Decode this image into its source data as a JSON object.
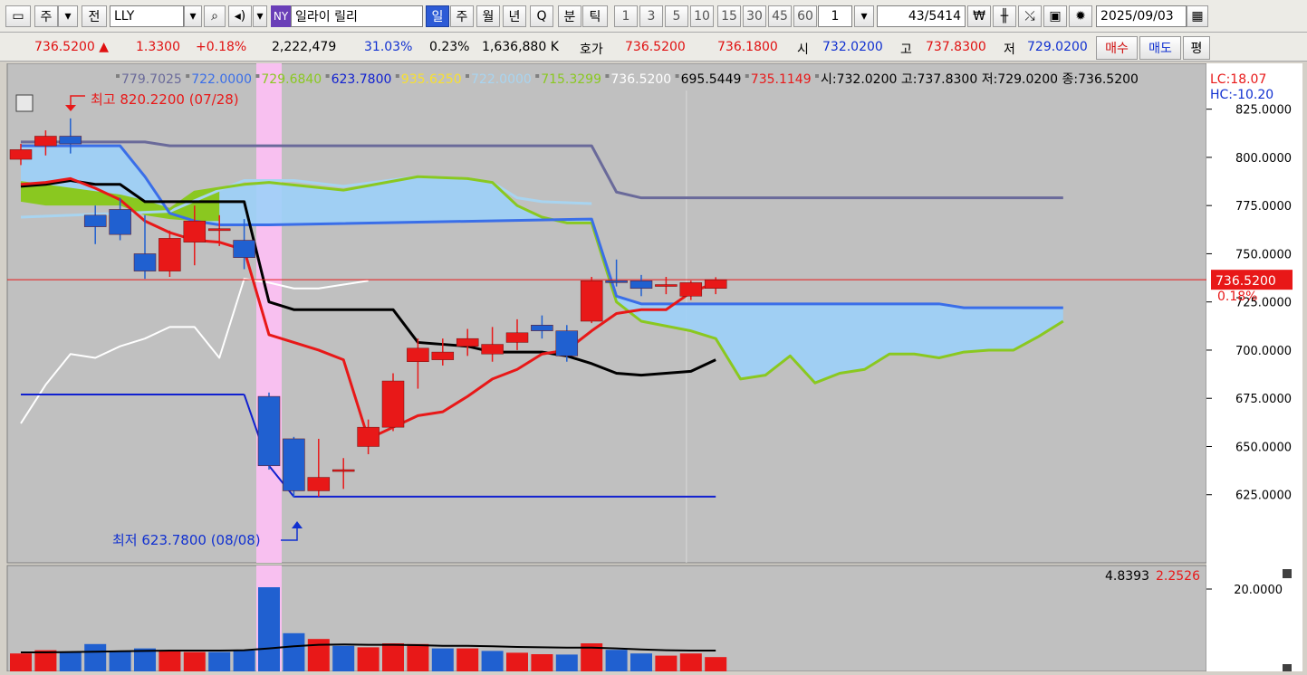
{
  "toolbar": {
    "period_label": "주",
    "prev_label": "전",
    "symbol_code": "LLY",
    "exchange_badge": "NY",
    "symbol_name": "일라이 릴리",
    "period_tabs": [
      "일",
      "주",
      "월",
      "년",
      "Q",
      "분",
      "틱"
    ],
    "minute_tabs": [
      "1",
      "3",
      "5",
      "10",
      "15",
      "30",
      "45",
      "60"
    ],
    "tick_value": "1",
    "counter": "43",
    "counter_total": "/5414",
    "date": "2025/09/03"
  },
  "quote": {
    "price": "736.5200",
    "change_arrow": "▲",
    "change": "1.3300",
    "change_pct": "+0.18%",
    "volume": "2,222,479",
    "vol_ratio": "31.03%",
    "turnover_pct": "0.23%",
    "amount": "1,636,880",
    "amount_unit": "K",
    "hoga_label": "호가",
    "ask": "736.5200",
    "bid": "736.1800",
    "open_label": "시",
    "open": "732.0200",
    "high_label": "고",
    "high": "737.8300",
    "low_label": "저",
    "low": "729.0200",
    "buy_label": "매수",
    "sell_label": "매도",
    "eval_label": "평"
  },
  "colors": {
    "up": "#e81818",
    "down": "#2060d0",
    "ma_black": "#000000",
    "ma_red": "#e81818",
    "ma_white": "#ffffff",
    "ichimoku_blue": "#3a6ee8",
    "ichimoku_navy": "#6a6a9a",
    "cloud_green": "#8ac820",
    "cloud_blue": "#9cd0f8",
    "chikou_lightblue": "#a8d4f0",
    "channel_blue": "#1020d0",
    "highlight": "#f8c0f0",
    "bg": "#c0c0c0"
  },
  "chart_data": [
    {
      "type": "candlestick",
      "legend": [
        {
          "text": "779.7025",
          "color": "#6a6a9a"
        },
        {
          "text": "722.0000",
          "color": "#3a6ee8"
        },
        {
          "text": "729.6840",
          "color": "#8ac820"
        },
        {
          "text": "623.7800",
          "color": "#1020d0"
        },
        {
          "text": "935.6250",
          "color": "#f8e030"
        },
        {
          "text": "722.0000",
          "color": "#a8d4f0"
        },
        {
          "text": "715.3299",
          "color": "#8ac820"
        },
        {
          "text": "736.5200",
          "color": "#ffffff"
        },
        {
          "text": "695.5449",
          "color": "#000000"
        },
        {
          "text": "735.1149",
          "color": "#e81818"
        },
        {
          "text": "시:732.0200 고:737.8300 저:729.0200 종:736.5200",
          "color": "#000000"
        }
      ],
      "lc_label": "LC:18.07",
      "hc_label": "HC:-10.20",
      "high_annotation": "최고 820.2200 (07/28)",
      "low_annotation": "최저 623.7800 (08/08)",
      "current_price_tag": "736.5200",
      "current_change_tag": "0.18%",
      "ylim": [
        600,
        830
      ],
      "y_ticks": [
        {
          "value": 825,
          "label": "825.0000"
        },
        {
          "value": 800,
          "label": "800.0000"
        },
        {
          "value": 775,
          "label": "775.0000"
        },
        {
          "value": 750,
          "label": "750.0000"
        },
        {
          "value": 725,
          "label": "725.0000"
        },
        {
          "value": 700,
          "label": "700.0000"
        },
        {
          "value": 675,
          "label": "675.0000"
        },
        {
          "value": 650,
          "label": "650.0000"
        },
        {
          "value": 625,
          "label": "625.0000"
        }
      ],
      "candles": [
        {
          "o": 799,
          "h": 807,
          "l": 796,
          "c": 804
        },
        {
          "o": 806,
          "h": 814,
          "l": 801,
          "c": 811
        },
        {
          "o": 811,
          "h": 820.22,
          "l": 802,
          "c": 807
        },
        {
          "o": 770,
          "h": 775,
          "l": 755,
          "c": 764
        },
        {
          "o": 773,
          "h": 779,
          "l": 757,
          "c": 760
        },
        {
          "o": 750,
          "h": 770,
          "l": 737,
          "c": 741
        },
        {
          "o": 741,
          "h": 762,
          "l": 738,
          "c": 758
        },
        {
          "o": 756,
          "h": 775,
          "l": 744,
          "c": 767
        },
        {
          "o": 762,
          "h": 770,
          "l": 754,
          "c": 763
        },
        {
          "o": 757,
          "h": 768,
          "l": 742,
          "c": 748
        },
        {
          "o": 676,
          "h": 678,
          "l": 638,
          "c": 640
        },
        {
          "o": 654,
          "h": 655,
          "l": 623.78,
          "c": 627
        },
        {
          "o": 627,
          "h": 654,
          "l": 624,
          "c": 634
        },
        {
          "o": 638,
          "h": 644,
          "l": 628,
          "c": 638
        },
        {
          "o": 650,
          "h": 664,
          "l": 646,
          "c": 660
        },
        {
          "o": 660,
          "h": 688,
          "l": 658,
          "c": 684
        },
        {
          "o": 694,
          "h": 706,
          "l": 680,
          "c": 701
        },
        {
          "o": 695,
          "h": 706,
          "l": 692,
          "c": 699
        },
        {
          "o": 702,
          "h": 711,
          "l": 697,
          "c": 706
        },
        {
          "o": 698,
          "h": 712,
          "l": 694,
          "c": 703
        },
        {
          "o": 704,
          "h": 716,
          "l": 700,
          "c": 709
        },
        {
          "o": 713,
          "h": 718,
          "l": 706,
          "c": 710
        },
        {
          "o": 710,
          "h": 713,
          "l": 694,
          "c": 697
        },
        {
          "o": 715,
          "h": 738,
          "l": 714,
          "c": 736
        },
        {
          "o": 736,
          "h": 747,
          "l": 733,
          "c": 735
        },
        {
          "o": 736,
          "h": 739,
          "l": 728,
          "c": 732
        },
        {
          "o": 734,
          "h": 738,
          "l": 729,
          "c": 734
        },
        {
          "o": 728,
          "h": 736,
          "l": 726,
          "c": 735
        },
        {
          "o": 732.02,
          "h": 737.83,
          "l": 729.02,
          "c": 736.52
        }
      ],
      "ma_black": [
        [
          0,
          785
        ],
        [
          1,
          786
        ],
        [
          2,
          788
        ],
        [
          3,
          786
        ],
        [
          4,
          786
        ],
        [
          5,
          777
        ],
        [
          6,
          777
        ],
        [
          7,
          777
        ],
        [
          8,
          777
        ],
        [
          9,
          777
        ],
        [
          10,
          725
        ],
        [
          11,
          721
        ],
        [
          12,
          721
        ],
        [
          13,
          721
        ],
        [
          14,
          721
        ],
        [
          15,
          721
        ],
        [
          16,
          704
        ],
        [
          17,
          703
        ],
        [
          18,
          702
        ],
        [
          19,
          699
        ],
        [
          20,
          699
        ],
        [
          21,
          699
        ],
        [
          22,
          697
        ],
        [
          23,
          693
        ],
        [
          24,
          688
        ],
        [
          25,
          687
        ],
        [
          26,
          688
        ],
        [
          27,
          689
        ],
        [
          28,
          695
        ]
      ],
      "ma_red": [
        [
          0,
          786
        ],
        [
          1,
          787
        ],
        [
          2,
          789
        ],
        [
          3,
          784
        ],
        [
          4,
          778
        ],
        [
          5,
          767
        ],
        [
          6,
          761
        ],
        [
          7,
          757
        ],
        [
          8,
          756
        ],
        [
          9,
          752
        ],
        [
          10,
          708
        ],
        [
          11,
          704
        ],
        [
          12,
          700
        ],
        [
          13,
          695
        ],
        [
          14,
          654
        ],
        [
          15,
          660
        ],
        [
          16,
          666
        ],
        [
          17,
          668
        ],
        [
          18,
          676
        ],
        [
          19,
          685
        ],
        [
          20,
          690
        ],
        [
          21,
          698
        ],
        [
          22,
          700
        ],
        [
          23,
          710
        ],
        [
          24,
          719
        ],
        [
          25,
          721
        ],
        [
          26,
          721
        ],
        [
          27,
          730
        ],
        [
          28,
          735
        ]
      ],
      "ma_white": [
        [
          0,
          662
        ],
        [
          1,
          682
        ],
        [
          2,
          698
        ],
        [
          3,
          696
        ],
        [
          4,
          702
        ],
        [
          5,
          706
        ],
        [
          6,
          712
        ],
        [
          7,
          712
        ],
        [
          8,
          696
        ],
        [
          9,
          737
        ],
        [
          10,
          735
        ],
        [
          11,
          732
        ],
        [
          12,
          732
        ],
        [
          13,
          734
        ],
        [
          14,
          736
        ]
      ],
      "ichimoku_navy": [
        [
          0,
          808
        ],
        [
          5,
          808
        ],
        [
          6,
          806
        ],
        [
          10,
          806
        ],
        [
          23,
          806
        ],
        [
          24,
          782
        ],
        [
          25,
          779
        ],
        [
          42,
          779
        ]
      ],
      "ichimoku_blue": [
        [
          0,
          806
        ],
        [
          4,
          806
        ],
        [
          5,
          790
        ],
        [
          6,
          771
        ],
        [
          7,
          767
        ],
        [
          8,
          765
        ],
        [
          10,
          765
        ],
        [
          23,
          768
        ],
        [
          24,
          728
        ],
        [
          25,
          724
        ],
        [
          30,
          724
        ],
        [
          37,
          724
        ],
        [
          38,
          722
        ],
        [
          42,
          722
        ]
      ],
      "chikou_lightblue": [
        [
          0,
          769
        ],
        [
          6,
          772
        ],
        [
          8,
          783
        ],
        [
          9,
          788
        ],
        [
          11,
          788
        ],
        [
          13,
          785
        ],
        [
          16,
          790
        ],
        [
          18,
          789
        ],
        [
          19,
          787
        ],
        [
          20,
          779
        ],
        [
          21,
          777
        ],
        [
          23,
          776
        ]
      ],
      "cloud_green": [
        [
          0,
          787
        ],
        [
          4,
          780
        ],
        [
          5,
          777
        ],
        [
          6,
          773
        ],
        [
          7,
          782
        ],
        [
          9,
          786
        ],
        [
          10,
          787
        ],
        [
          13,
          783
        ],
        [
          16,
          790
        ],
        [
          18,
          789
        ],
        [
          19,
          787
        ],
        [
          20,
          775
        ],
        [
          21,
          769
        ],
        [
          22,
          766
        ],
        [
          23,
          766
        ],
        [
          24,
          725
        ],
        [
          25,
          715
        ],
        [
          27,
          710
        ],
        [
          28,
          706
        ],
        [
          29,
          685
        ],
        [
          30,
          687
        ],
        [
          31,
          697
        ],
        [
          32,
          683
        ],
        [
          33,
          688
        ],
        [
          34,
          690
        ],
        [
          35,
          698
        ],
        [
          36,
          698
        ],
        [
          37,
          696
        ],
        [
          38,
          699
        ],
        [
          39,
          700
        ],
        [
          40,
          700
        ],
        [
          41,
          707
        ],
        [
          42,
          715
        ]
      ],
      "channel_top": [
        [
          0,
          677
        ],
        [
          9,
          677
        ]
      ],
      "channel_bottom": [
        [
          9,
          677
        ],
        [
          10,
          640
        ],
        [
          11,
          624
        ],
        [
          28,
          624
        ]
      ],
      "highlight_index": 10
    },
    {
      "type": "bar",
      "values": [
        2.2,
        3.1,
        2.5,
        4.8,
        3.0,
        3.6,
        3.0,
        2.6,
        2.6,
        3.0,
        20.5,
        7.8,
        6.2,
        4.3,
        3.9,
        5.0,
        4.8,
        3.6,
        3.6,
        2.9,
        2.4,
        2.0,
        1.9,
        5.0,
        3.2,
        2.2,
        1.6,
        2.2,
        1.2
      ],
      "up": [
        true,
        true,
        false,
        false,
        false,
        false,
        true,
        true,
        false,
        false,
        false,
        false,
        true,
        false,
        true,
        true,
        true,
        false,
        true,
        false,
        true,
        true,
        false,
        true,
        false,
        false,
        true,
        true,
        true
      ],
      "ma_values": [
        2.5,
        2.5,
        2.6,
        2.7,
        2.8,
        2.9,
        3.0,
        3.0,
        3.0,
        3.1,
        3.6,
        4.2,
        4.6,
        4.7,
        4.6,
        4.6,
        4.5,
        4.3,
        4.3,
        4.2,
        4.0,
        3.9,
        3.8,
        3.8,
        3.6,
        3.3,
        3.1,
        3.0,
        3.0
      ],
      "ylim": [
        0,
        24
      ],
      "y_ticks": [
        {
          "value": 20,
          "label": "20.0000"
        }
      ],
      "legend_values": [
        {
          "text": "4.8393",
          "color": "#000000"
        },
        {
          "text": "2.2526",
          "color": "#e81818"
        }
      ]
    }
  ]
}
